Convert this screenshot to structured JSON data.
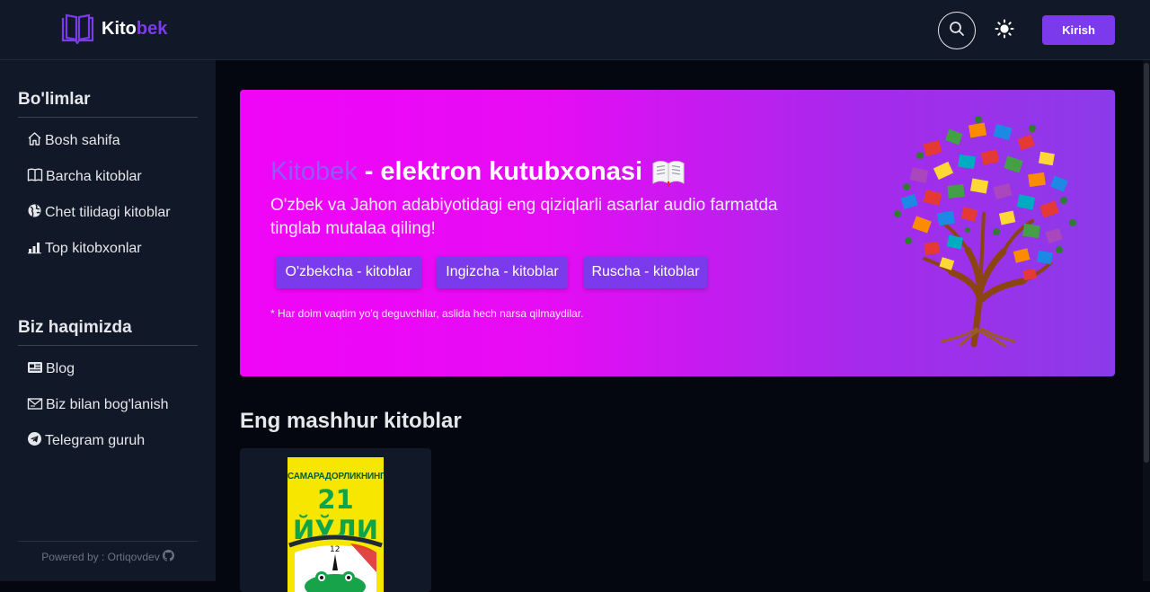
{
  "header": {
    "logo_main": "Kito",
    "logo_accent": "bek",
    "login_label": "Kirish",
    "icons": {
      "search": "search-icon",
      "theme": "sun-icon",
      "logo": "open-book-icon"
    }
  },
  "sidebar": {
    "section1_title": "Bo'limlar",
    "section1_items": [
      {
        "label": "Bosh sahifa",
        "icon": "home-icon"
      },
      {
        "label": "Barcha kitoblar",
        "icon": "book-icon"
      },
      {
        "label": "Chet tilidagi kitoblar",
        "icon": "globe-icon"
      },
      {
        "label": "Top kitobxonlar",
        "icon": "bar-chart-icon"
      }
    ],
    "section2_title": "Biz haqimizda",
    "section2_items": [
      {
        "label": "Blog",
        "icon": "newspaper-icon"
      },
      {
        "label": "Biz bilan bog'lanish",
        "icon": "envelope-icon"
      },
      {
        "label": "Telegram guruh",
        "icon": "telegram-icon"
      }
    ],
    "powered": "Powered by : Ortiqovdev"
  },
  "hero": {
    "brand": "Kitobek",
    "separator": "-",
    "title_rest": "elektron kutubxonasi",
    "subtitle": "O'zbek va Jahon adabiyotidagi eng qiziqlarli asarlar audio farmatda tinglab mutalaa qiling!",
    "buttons": [
      "O'zbekcha - kitoblar",
      "Ingizcha - kitoblar",
      "Ruscha - kitoblar"
    ],
    "note": "* Har doim vaqtim yo'q deguvchilar, aslida hech narsa qilmaydilar."
  },
  "popular": {
    "heading": "Eng mashhur kitoblar",
    "book_cover_top": "САМАРАДОРЛИКНИНГ",
    "book_cover_big": "21 ЙЎЛИ"
  },
  "colors": {
    "accent": "#7c3aed",
    "header_bg": "#111827",
    "page_bg": "#04070f",
    "hero_start": "#f005f7",
    "hero_end": "#8b3be9"
  }
}
